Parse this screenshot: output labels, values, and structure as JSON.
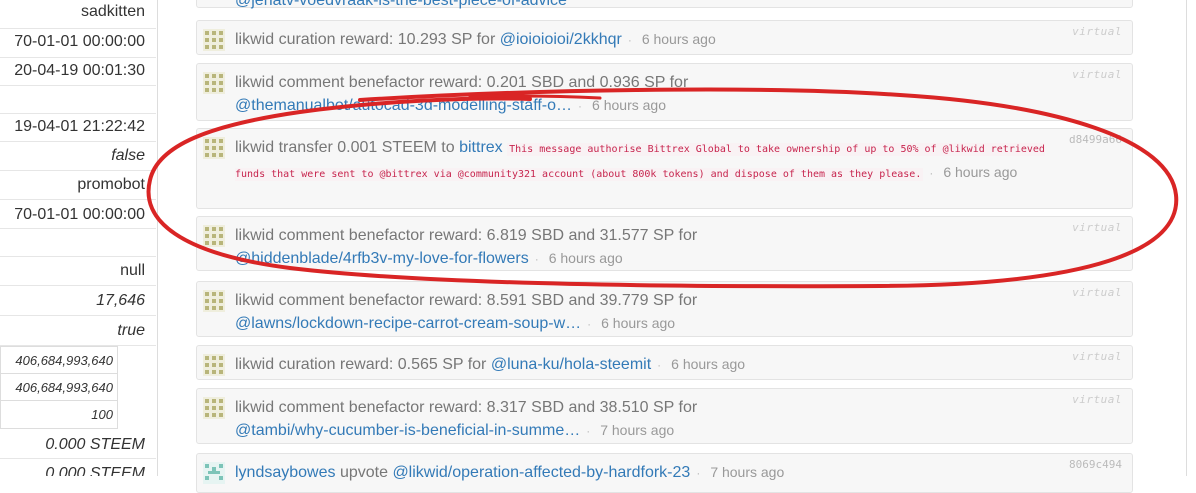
{
  "left_panel": {
    "rows": [
      {
        "value": "sadkitten",
        "italic": false
      },
      {
        "value": "70-01-01 00:00:00",
        "italic": false
      },
      {
        "value": "20-04-19 00:01:30",
        "italic": false
      },
      {
        "value": "",
        "italic": false
      },
      {
        "value": "19-04-01 21:22:42",
        "italic": false
      },
      {
        "value": "false",
        "italic": true
      },
      {
        "value": "promobot",
        "italic": false
      },
      {
        "value": "70-01-01 00:00:00",
        "italic": false
      },
      {
        "value": "",
        "italic": false
      },
      {
        "value": "null",
        "italic": false
      },
      {
        "value": "17,646",
        "italic": true
      },
      {
        "value": "true",
        "italic": true
      }
    ],
    "subtable": [
      "406,684,993,640",
      "406,684,993,640",
      "100"
    ],
    "balance_1": "0.000 STEEM",
    "balance_2": "0.000 STEEM"
  },
  "feed": {
    "top_partial_link": "@jenatv-voedvraak-is-the-best-piece-of-advice",
    "operations": [
      {
        "text": "likwid curation reward: 10.293 SP for ",
        "link": "@ioioioioi/2kkhqr",
        "time": "6 hours ago",
        "tag": "virtual"
      },
      {
        "text": "likwid comment benefactor reward: 0.201 SBD and 0.936 SP for",
        "link": "@themanualbot/autocad-3d-modelling-staff-o…",
        "time": "6 hours ago",
        "tag": "virtual"
      },
      {
        "text": "likwid transfer 0.001 STEEM to ",
        "link": "bittrex",
        "memo": "This message authorise Bittrex Global to take ownership of up to 50% of @likwid retrieved funds that were sent to @bittrex via @community321 account (about 800k tokens) and dispose of them as they please.",
        "time": "6 hours ago",
        "tag": "d8499a66"
      },
      {
        "text": "likwid comment benefactor reward: 6.819 SBD and 31.577 SP for",
        "link": "@hiddenblade/4rfb3v-my-love-for-flowers",
        "time": "6 hours ago",
        "tag": "virtual"
      },
      {
        "text": "likwid comment benefactor reward: 8.591 SBD and 39.779 SP for",
        "link": "@lawns/lockdown-recipe-carrot-cream-soup-w…",
        "time": "6 hours ago",
        "tag": "virtual"
      },
      {
        "text": "likwid curation reward: 0.565 SP for ",
        "link": "@luna-ku/hola-steemit",
        "time": "6 hours ago",
        "tag": "virtual"
      },
      {
        "text": "likwid comment benefactor reward: 8.317 SBD and 38.510 SP for",
        "link": "@tambi/why-cucumber-is-beneficial-in-summe…",
        "time": "7 hours ago",
        "tag": "virtual"
      },
      {
        "user": "lyndsaybowes",
        "text": " upvote ",
        "link": "@likwid/operation-affected-by-hardfork-23",
        "time": "7 hours ago",
        "tag": "8069c494"
      }
    ]
  },
  "colors": {
    "link": "#337ab7",
    "memo_text": "#c7254e",
    "annotation_stroke": "#d92525"
  },
  "icons": {
    "identicon": "identicon-avatar",
    "annotation": "red-hand-drawn-ellipse"
  }
}
